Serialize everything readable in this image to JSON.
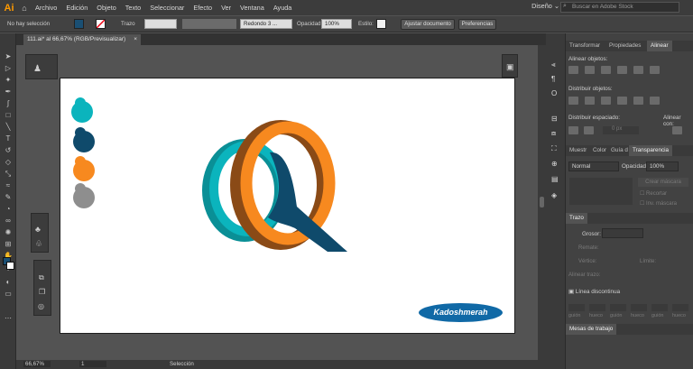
{
  "app": {
    "logo": "Ai",
    "home_icon": "home-icon"
  },
  "menu": [
    "Archivo",
    "Edición",
    "Objeto",
    "Texto",
    "Seleccionar",
    "Efecto",
    "Ver",
    "Ventana",
    "Ayuda"
  ],
  "workspace": "Diseño",
  "search": {
    "placeholder": "Buscar en Adobe Stock"
  },
  "control": {
    "selection": "No hay selección",
    "stroke_label": "Trazo",
    "brush": "Redondo 3 ...",
    "opacity_label": "Opacidad:",
    "opacity_value": "100%",
    "style_label": "Estilo:",
    "adjust_button": "Ajustar documento",
    "prefs_button": "Preferencias",
    "fill_color": "#1a4f73"
  },
  "document": {
    "tab_title": "111.ai* al 66,67% (RGB/Previsualizar)",
    "close": "×"
  },
  "artwork": {
    "colors": [
      "#0bb4bd",
      "#0f4a6b",
      "#f7891f",
      "#8e8e8e"
    ],
    "badge_text": "Kadoshmerah"
  },
  "panels": {
    "top_tabs": [
      "Transformar",
      "Propiedades",
      "Alinear"
    ],
    "align_objects": "Alinear objetos:",
    "distribute_objects": "Distribuir objetos:",
    "distribute_spacing": "Distribuir espaciado:",
    "align_to": "Alinear con:",
    "spacing_value": "0 px",
    "mid_tabs": [
      "Muestr",
      "Color",
      "Guía d",
      "Transparencia"
    ],
    "blend_mode": "Normal",
    "opacity_label": "Opacidad:",
    "opacity_value": "100%",
    "make_mask": "Crear máscara",
    "clip": "Recortar",
    "invert_mask": "Inv. máscara",
    "stroke_title": "Trazo",
    "weight_label": "Grosor:",
    "cap_label": "Remate:",
    "corner_label": "Vértice:",
    "limit_label": "Límite:",
    "align_stroke": "Alinear trazo:",
    "dashed": "Línea discontinua",
    "dash_labels": [
      "guión",
      "hueco",
      "guión",
      "hueco",
      "guión",
      "hueco"
    ],
    "artboards_title": "Mesas de trabajo"
  },
  "status": {
    "zoom": "66,67%",
    "page": "1",
    "tool": "Selección"
  }
}
